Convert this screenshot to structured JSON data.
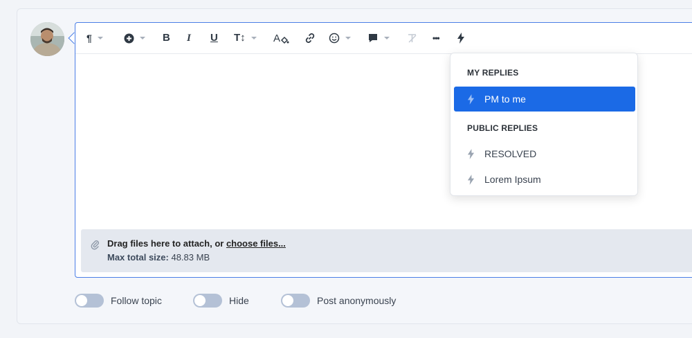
{
  "toolbar": {
    "items": [
      {
        "name": "paragraph-icon",
        "glyph": "¶",
        "caret": true
      },
      {
        "name": "insert-icon",
        "caret": true
      },
      {
        "name": "bold-icon",
        "glyph": "B"
      },
      {
        "name": "italic-icon",
        "glyph": "I"
      },
      {
        "name": "underline-icon",
        "glyph": "U"
      },
      {
        "name": "text-size-icon",
        "glyph": "T↕",
        "caret": true
      },
      {
        "name": "text-color-icon",
        "glyph": "A"
      },
      {
        "name": "link-icon"
      },
      {
        "name": "emoji-icon",
        "caret": true
      },
      {
        "name": "comment-icon",
        "caret": true
      },
      {
        "name": "clear-format-icon"
      },
      {
        "name": "more-icon",
        "glyph": "···"
      },
      {
        "name": "quick-reply-icon"
      }
    ]
  },
  "attach": {
    "drag_text": "Drag files here to attach, or ",
    "choose_link": "choose files...",
    "max_label": "Max total size:",
    "max_value": " 48.83 MB"
  },
  "toggles": {
    "follow": "Follow topic",
    "hide": "Hide",
    "anonymous": "Post anonymously"
  },
  "menu": {
    "my_header": "MY REPLIES",
    "my_items": [
      "PM to me"
    ],
    "public_header": "PUBLIC REPLIES",
    "public_items": [
      "RESOLVED",
      "Lorem Ipsum"
    ],
    "active_item": "PM to me",
    "accent_color": "#1b6ae6"
  }
}
